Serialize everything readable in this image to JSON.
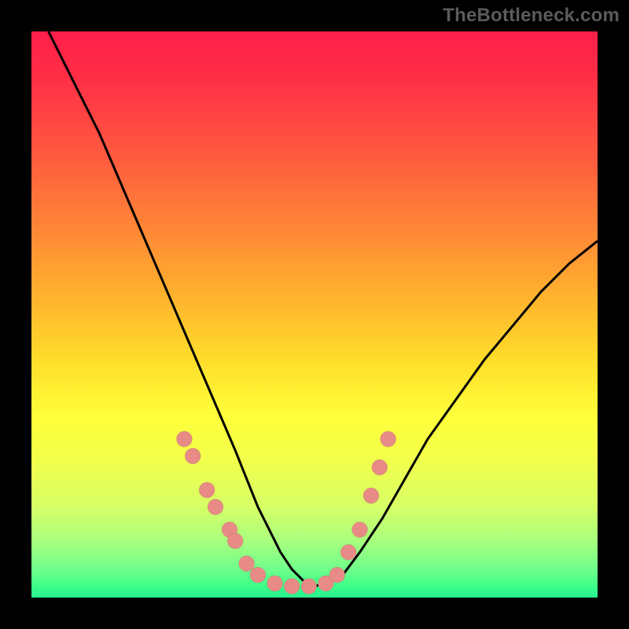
{
  "watermark": "TheBottleneck.com",
  "chart_data": {
    "type": "line",
    "title": "",
    "xlabel": "",
    "ylabel": "",
    "xlim": [
      0,
      100
    ],
    "ylim": [
      0,
      100
    ],
    "curve": {
      "x": [
        3,
        6,
        9,
        12,
        15,
        18,
        21,
        24,
        27,
        30,
        33,
        36,
        38,
        40,
        42,
        44,
        46,
        48,
        50,
        52,
        55,
        58,
        62,
        66,
        70,
        75,
        80,
        85,
        90,
        95,
        100
      ],
      "y": [
        100,
        94,
        88,
        82,
        75,
        68,
        61,
        54,
        47,
        40,
        33,
        26,
        21,
        16,
        12,
        8,
        5,
        3,
        2,
        2.5,
        4,
        8,
        14,
        21,
        28,
        35,
        42,
        48,
        54,
        59,
        63
      ]
    },
    "markers": [
      {
        "x": 27,
        "y": 28
      },
      {
        "x": 28.5,
        "y": 25
      },
      {
        "x": 31,
        "y": 19
      },
      {
        "x": 32.5,
        "y": 16
      },
      {
        "x": 35,
        "y": 12
      },
      {
        "x": 36,
        "y": 10
      },
      {
        "x": 38,
        "y": 6
      },
      {
        "x": 40,
        "y": 4
      },
      {
        "x": 43,
        "y": 2.5
      },
      {
        "x": 46,
        "y": 2
      },
      {
        "x": 49,
        "y": 2
      },
      {
        "x": 52,
        "y": 2.5
      },
      {
        "x": 54,
        "y": 4
      },
      {
        "x": 56,
        "y": 8
      },
      {
        "x": 58,
        "y": 12
      },
      {
        "x": 60,
        "y": 18
      },
      {
        "x": 61.5,
        "y": 23
      },
      {
        "x": 63,
        "y": 28
      }
    ],
    "gradient_stops": [
      {
        "pos": 0.0,
        "color": "#ff1f4a"
      },
      {
        "pos": 0.68,
        "color": "#ffff3a"
      },
      {
        "pos": 1.0,
        "color": "#27f08f"
      }
    ]
  }
}
